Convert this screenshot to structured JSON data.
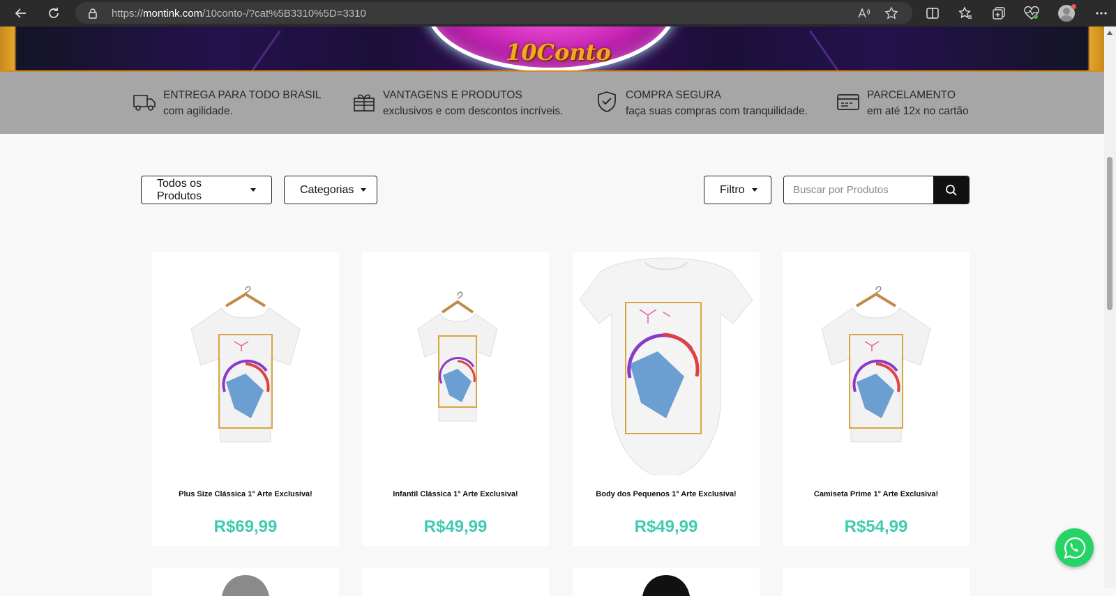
{
  "browser": {
    "url_prefix": "https://",
    "url_domain": "montink.com",
    "url_path": "/10conto-/?cat%5B3310%5D=3310"
  },
  "banner": {
    "logo_text": "10Conto"
  },
  "features": [
    {
      "icon": "truck-icon",
      "title": "ENTREGA PARA TODO BRASIL",
      "subtitle": "com agilidade."
    },
    {
      "icon": "gift-icon",
      "title": "VANTAGENS E PRODUTOS",
      "subtitle": "exclusivos e com descontos incríveis."
    },
    {
      "icon": "shield-check-icon",
      "title": "COMPRA SEGURA",
      "subtitle": "faça suas compras com tranquilidade."
    },
    {
      "icon": "credit-card-icon",
      "title": "PARCELAMENTO",
      "subtitle": "em até 12x no cartão"
    }
  ],
  "filters": {
    "all_products": "Todos os Produtos",
    "categories": "Categorias",
    "filter": "Filtro",
    "search_placeholder": "Buscar por Produtos"
  },
  "products": [
    {
      "name": "Plus Size Clássica 1° Arte Exclusiva!",
      "price": "R$69,99",
      "type": "t-shirt-hanger"
    },
    {
      "name": "Infantil Clássica 1° Arte Exclusiva!",
      "price": "R$49,99",
      "type": "kids-shirt-hanger"
    },
    {
      "name": "Body dos Pequenos 1° Arte Exclusiva!",
      "price": "R$49,99",
      "type": "baby-body"
    },
    {
      "name": "Camiseta Prime 1° Arte Exclusiva!",
      "price": "R$54,99",
      "type": "t-shirt-hanger"
    }
  ],
  "colors": {
    "price": "#3fcbb1",
    "features_bg": "#a6a6a6",
    "whatsapp": "#25d366"
  }
}
